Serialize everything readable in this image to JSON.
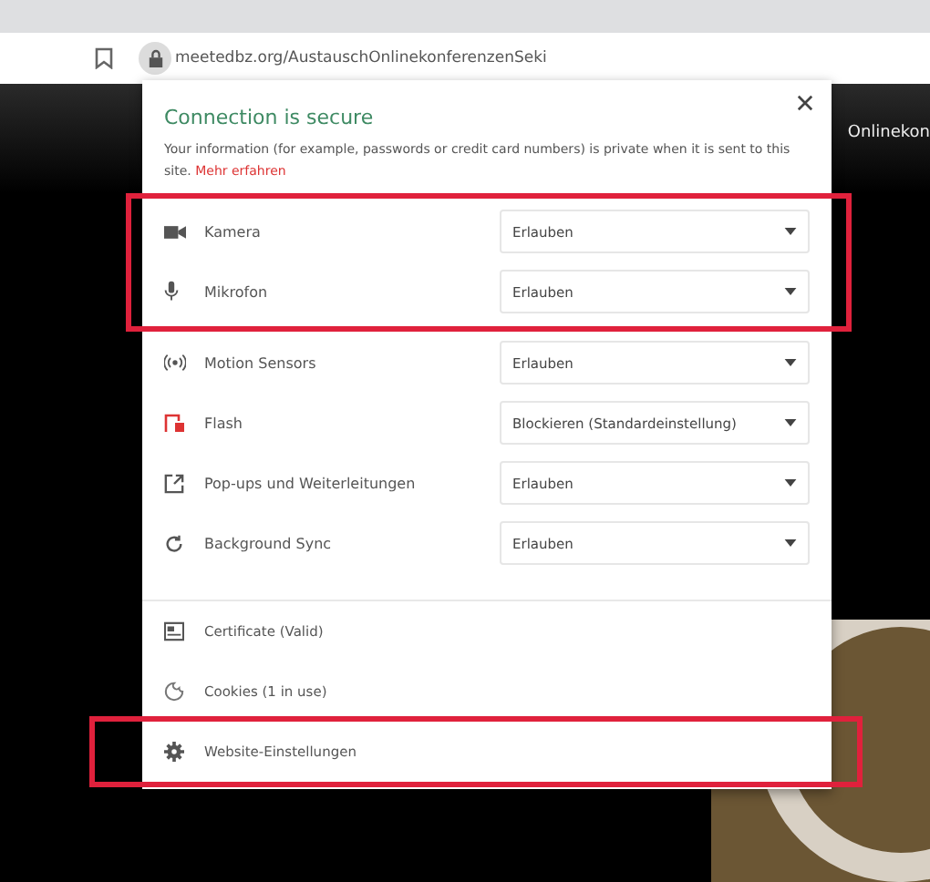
{
  "address_bar": {
    "url": "meetedbz.org/AustauschOnlinekonferenzenSeki"
  },
  "page": {
    "heading_fragment": "Onlinekon"
  },
  "popup": {
    "title": "Connection is secure",
    "description": "Your information (for example, passwords or credit card numbers) is private when it is sent to this site.",
    "link": "Mehr erfahren",
    "permission_groups": [
      {
        "highlighted": true,
        "items": [
          {
            "kind": "camera",
            "label": "Kamera",
            "value": "Erlauben"
          },
          {
            "kind": "mic",
            "label": "Mikrofon",
            "value": "Erlauben"
          }
        ]
      },
      {
        "highlighted": false,
        "items": [
          {
            "kind": "sensors",
            "label": "Motion Sensors",
            "value": "Erlauben"
          },
          {
            "kind": "flash",
            "label": "Flash",
            "value": "Blockieren (Standardeinstellung)"
          },
          {
            "kind": "popups",
            "label": "Pop-ups und Weiterleitungen",
            "value": "Erlauben"
          },
          {
            "kind": "sync",
            "label": "Background Sync",
            "value": "Erlauben"
          }
        ]
      }
    ],
    "links": [
      {
        "kind": "certificate",
        "label": "Certificate (Valid)",
        "highlighted": false
      },
      {
        "kind": "cookies",
        "label": "Cookies (1 in use)",
        "highlighted": false
      },
      {
        "kind": "settings",
        "label": "Website-Einstellungen",
        "highlighted": true
      }
    ]
  }
}
